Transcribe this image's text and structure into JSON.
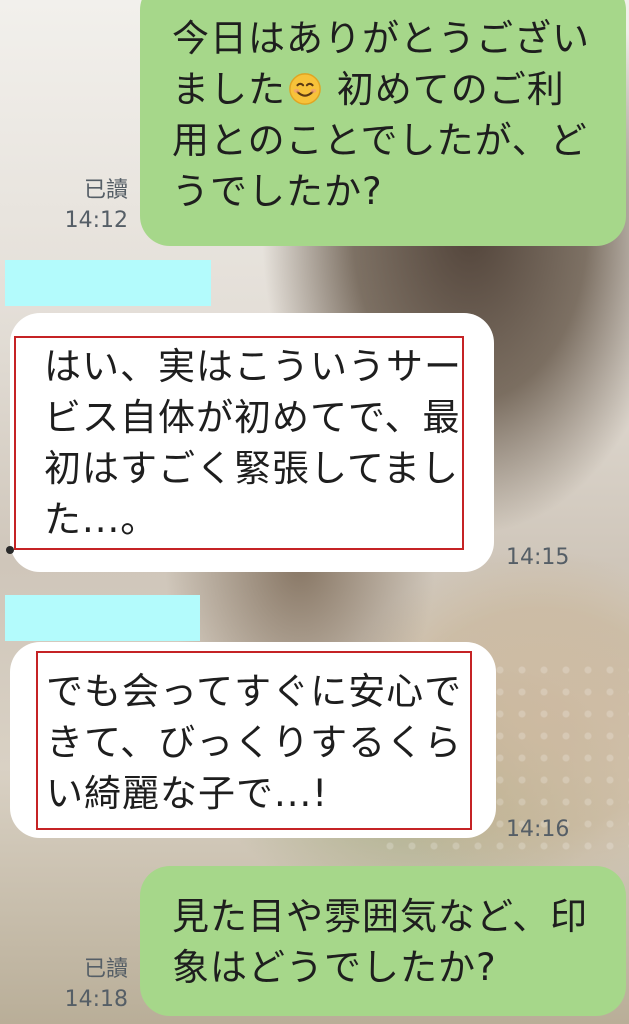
{
  "messages": [
    {
      "id": "m1",
      "direction": "outgoing",
      "text_before_emoji": "今日はありがとうござい\nました",
      "emoji": "smiling-face-emoji",
      "text_after_emoji": " 初めてのご利\n用とのことでしたが、ど\nうでしたか?",
      "read_label": "已讀",
      "time": "14:12"
    },
    {
      "id": "m2",
      "direction": "incoming",
      "text": "はい、実はこういうサー\nビス自体が初めてで、最\n初はすごく緊張してまし\nた...。",
      "time": "14:15"
    },
    {
      "id": "m3",
      "direction": "incoming",
      "text": "でも会ってすぐに安心で\nきて、びっくりするくら\nい綺麗な子で...!",
      "time": "14:16"
    },
    {
      "id": "m4",
      "direction": "outgoing",
      "text": "見た目や雰囲気など、印\n象はどうでしたか?",
      "read_label": "已讀",
      "time": "14:18"
    }
  ],
  "colors": {
    "outgoing_bubble": "#a6d78a",
    "incoming_bubble": "#ffffff",
    "highlight_box": "#c52325",
    "redaction_strip": "#b3fbfc"
  }
}
